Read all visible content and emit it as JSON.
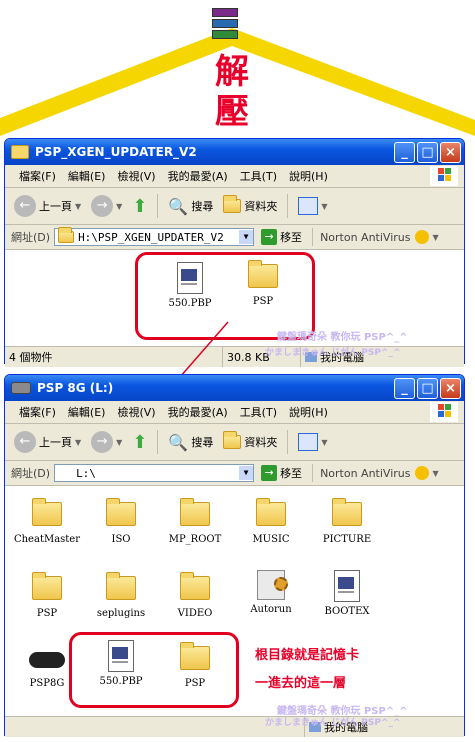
{
  "banner": {
    "chars": [
      "解",
      "壓"
    ],
    "icon": "winrar-icon"
  },
  "win1": {
    "title": "PSP_XGEN_UPDATER_V2",
    "menu": [
      "檔案(F)",
      "編輯(E)",
      "檢視(V)",
      "我的最愛(A)",
      "工具(T)",
      "說明(H)"
    ],
    "back": "上一頁",
    "search": "搜尋",
    "folders": "資料夾",
    "addr_label": "網址(D)",
    "addr_value": "H:\\PSP_XGEN_UPDATER_V2",
    "go": "移至",
    "norton": "Norton AntiVirus",
    "files": [
      "550.PBP",
      "PSP"
    ],
    "status_count": "4 個物件",
    "status_size": "30.8 KB",
    "status_loc": "我的電腦",
    "watermark1": "鍵盤瑪奇朵 教你玩 PSP^_^",
    "watermark2": "かましまきゅん じがん PSP^_^"
  },
  "win2": {
    "title": "PSP 8G (L:)",
    "menu": [
      "檔案(F)",
      "編輯(E)",
      "檢視(V)",
      "我的最愛(A)",
      "工具(T)",
      "說明(H)"
    ],
    "back": "上一頁",
    "search": "搜尋",
    "folders": "資料夾",
    "addr_label": "網址(D)",
    "addr_value": "L:\\",
    "go": "移至",
    "norton": "Norton AntiVirus",
    "files": [
      "CheatMaster",
      "ISO",
      "MP_ROOT",
      "MUSIC",
      "PICTURE",
      "PSP",
      "seplugins",
      "VIDEO",
      "Autorun",
      "BOOTEX",
      "PSP8G",
      "550.PBP",
      "PSP"
    ],
    "note1": "根目錄就是記憶卡",
    "note2": "一進去的這一層",
    "status_loc": "我的電腦",
    "watermark1": "鍵盤瑪奇朵 教你玩 PSP^_^",
    "watermark2": "かましまきゅん じがん PSP^_^"
  },
  "colors": {
    "accent_red": "#e8002a",
    "roof_yellow": "#f5d600",
    "title_blue": "#0a56e0"
  }
}
